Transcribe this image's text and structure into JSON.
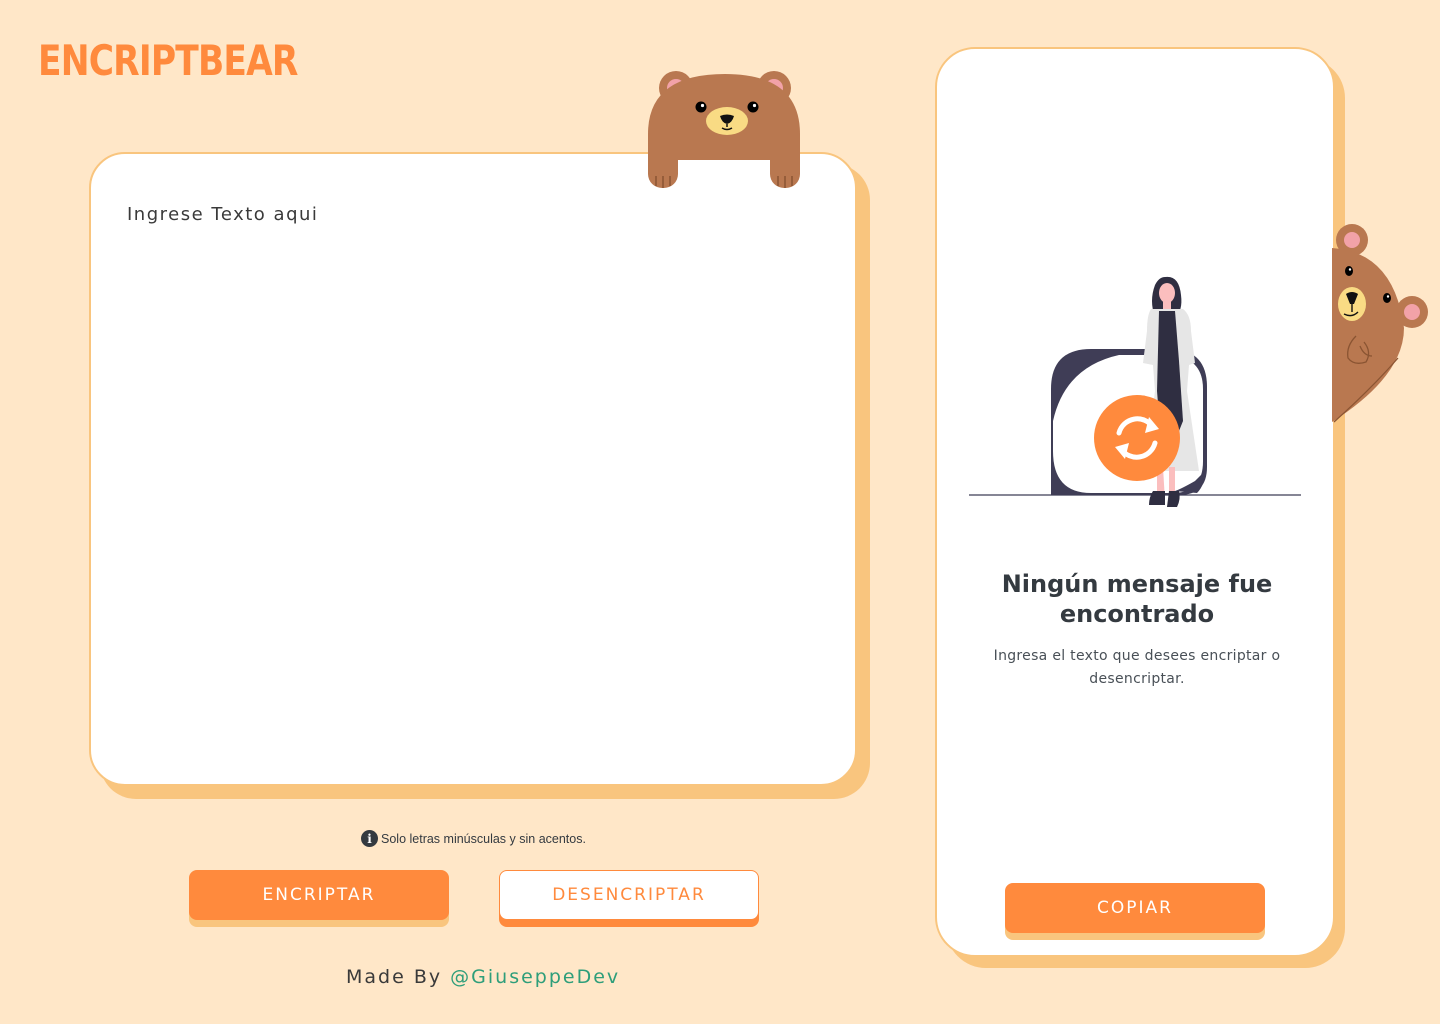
{
  "brand": {
    "logo_text": "ENCRIPTBEAR"
  },
  "input": {
    "placeholder": "Ingrese Texto aqui",
    "value": ""
  },
  "hint": {
    "icon": "info-icon",
    "text": "Solo letras minúsculas y sin acentos."
  },
  "actions": {
    "encrypt_label": "ENCRIPTAR",
    "decrypt_label": "DESENCRIPTAR",
    "copy_label": "COPIAR"
  },
  "output": {
    "empty_title": "Ningún mensaje fue encontrado",
    "empty_subtitle": "Ingresa el texto que desees encriptar o desencriptar."
  },
  "footer": {
    "made_by": "Made By",
    "author": "@GiuseppeDev"
  },
  "colors": {
    "background": "#FFE7C8",
    "accent": "#FF8A3D",
    "card_shadow": "#F9C57E",
    "bear_brown": "#B97850",
    "author_link": "#2E9E7A",
    "text_dark": "#343A40"
  }
}
